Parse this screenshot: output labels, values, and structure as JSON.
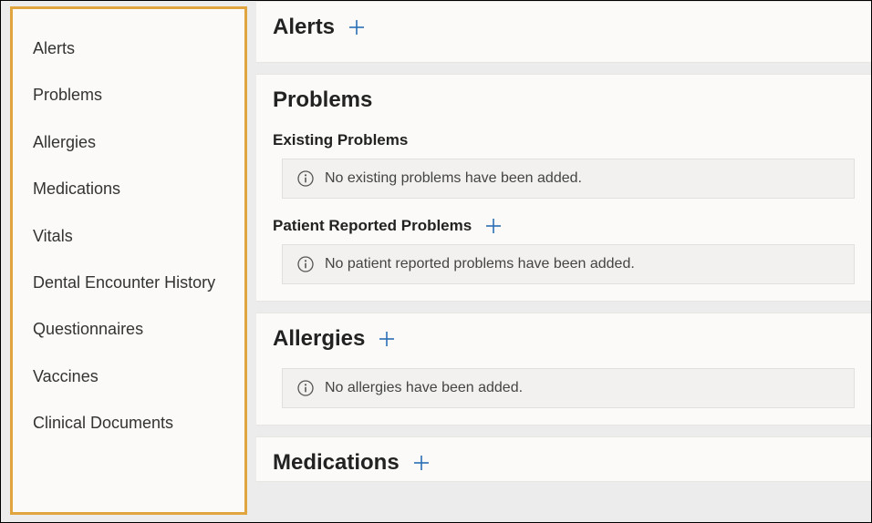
{
  "sidebar": {
    "items": [
      {
        "label": "Alerts"
      },
      {
        "label": "Problems"
      },
      {
        "label": "Allergies"
      },
      {
        "label": "Medications"
      },
      {
        "label": "Vitals"
      },
      {
        "label": "Dental Encounter History"
      },
      {
        "label": "Questionnaires"
      },
      {
        "label": "Vaccines"
      },
      {
        "label": "Clinical Documents"
      }
    ]
  },
  "sections": {
    "alerts": {
      "title": "Alerts"
    },
    "problems": {
      "title": "Problems",
      "existing_heading": "Existing Problems",
      "existing_empty": "No existing problems have been added.",
      "reported_heading": "Patient Reported Problems",
      "reported_empty": "No patient reported problems have been added."
    },
    "allergies": {
      "title": "Allergies",
      "empty": "No allergies have been added."
    },
    "medications": {
      "title": "Medications"
    }
  },
  "icons": {
    "plus_color": "#2a6fb5",
    "info_color": "#555"
  }
}
